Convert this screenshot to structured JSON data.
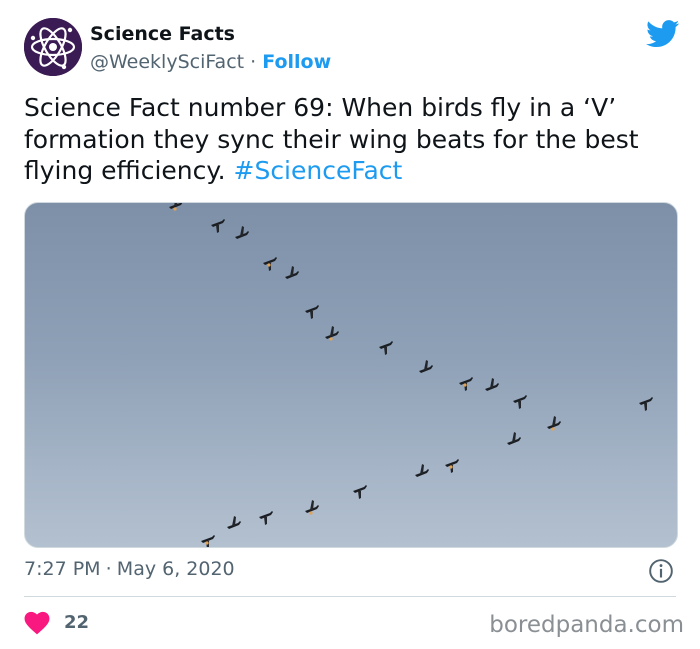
{
  "account": {
    "name": "Science Facts",
    "handle": "@WeeklySciFact",
    "separator": "·",
    "follow_label": "Follow",
    "avatar_icon": "atom-icon",
    "platform_icon": "twitter-bird-icon"
  },
  "tweet": {
    "text": "Science Fact number 69: When birds fly in a ‘V’ formation they sync their wing beats for the best flying efficiency. ",
    "hashtag": "#ScienceFact",
    "image_description_icon": "photo-of-birds-in-v-formation"
  },
  "meta": {
    "time": "7:27 PM",
    "separator": "·",
    "date": "May 6, 2020",
    "info_icon": "info-icon"
  },
  "engagement": {
    "like_icon": "heart-icon",
    "like_count": "22"
  },
  "watermark": "boredpanda.com",
  "colors": {
    "accent": "#1d9bf0",
    "heart": "#f91880",
    "text_primary": "#0f1419",
    "text_secondary": "#536471"
  }
}
